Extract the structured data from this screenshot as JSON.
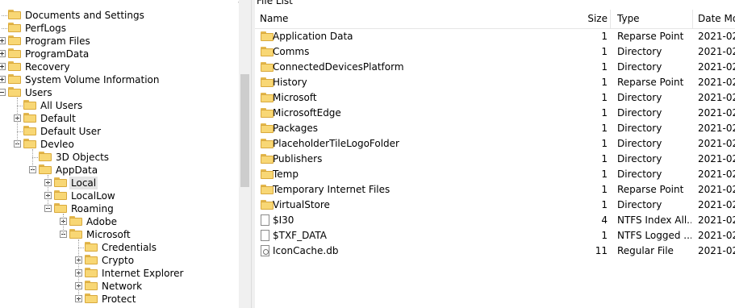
{
  "tree": {
    "close_glyph": "×",
    "items": [
      {
        "label": "Documents and Settings",
        "depth": 0,
        "expander": "none"
      },
      {
        "label": "PerfLogs",
        "depth": 0,
        "expander": "none"
      },
      {
        "label": "Program Files",
        "depth": 0,
        "expander": "plus"
      },
      {
        "label": "ProgramData",
        "depth": 0,
        "expander": "plus"
      },
      {
        "label": "Recovery",
        "depth": 0,
        "expander": "plus"
      },
      {
        "label": "System Volume Information",
        "depth": 0,
        "expander": "plus"
      },
      {
        "label": "Users",
        "depth": 0,
        "expander": "minus"
      },
      {
        "label": "All Users",
        "depth": 1,
        "expander": "none"
      },
      {
        "label": "Default",
        "depth": 1,
        "expander": "plus"
      },
      {
        "label": "Default User",
        "depth": 1,
        "expander": "none"
      },
      {
        "label": "Devleo",
        "depth": 1,
        "expander": "minus"
      },
      {
        "label": "3D Objects",
        "depth": 2,
        "expander": "none"
      },
      {
        "label": "AppData",
        "depth": 2,
        "expander": "minus"
      },
      {
        "label": "Local",
        "depth": 3,
        "expander": "plus",
        "selected": true
      },
      {
        "label": "LocalLow",
        "depth": 3,
        "expander": "plus"
      },
      {
        "label": "Roaming",
        "depth": 3,
        "expander": "minus"
      },
      {
        "label": "Adobe",
        "depth": 4,
        "expander": "plus"
      },
      {
        "label": "Microsoft",
        "depth": 4,
        "expander": "minus"
      },
      {
        "label": "Credentials",
        "depth": 5,
        "expander": "none"
      },
      {
        "label": "Crypto",
        "depth": 5,
        "expander": "plus"
      },
      {
        "label": "Internet Explorer",
        "depth": 5,
        "expander": "plus"
      },
      {
        "label": "Network",
        "depth": 5,
        "expander": "plus"
      },
      {
        "label": "Protect",
        "depth": 5,
        "expander": "plus"
      }
    ]
  },
  "list": {
    "title": "File List",
    "columns": {
      "name": "Name",
      "size": "Size",
      "type": "Type",
      "date": "Date Mo"
    },
    "rows": [
      {
        "icon": "folder",
        "name": "Application Data",
        "size": "1",
        "type": "Reparse Point",
        "date": "2021-02"
      },
      {
        "icon": "folder",
        "name": "Comms",
        "size": "1",
        "type": "Directory",
        "date": "2021-02"
      },
      {
        "icon": "folder",
        "name": "ConnectedDevicesPlatform",
        "size": "1",
        "type": "Directory",
        "date": "2021-02"
      },
      {
        "icon": "folder",
        "name": "History",
        "size": "1",
        "type": "Reparse Point",
        "date": "2021-02"
      },
      {
        "icon": "folder",
        "name": "Microsoft",
        "size": "1",
        "type": "Directory",
        "date": "2021-02"
      },
      {
        "icon": "folder",
        "name": "MicrosoftEdge",
        "size": "1",
        "type": "Directory",
        "date": "2021-02"
      },
      {
        "icon": "folder",
        "name": "Packages",
        "size": "1",
        "type": "Directory",
        "date": "2021-02"
      },
      {
        "icon": "folder",
        "name": "PlaceholderTileLogoFolder",
        "size": "1",
        "type": "Directory",
        "date": "2021-02"
      },
      {
        "icon": "folder",
        "name": "Publishers",
        "size": "1",
        "type": "Directory",
        "date": "2021-02"
      },
      {
        "icon": "folder",
        "name": "Temp",
        "size": "1",
        "type": "Directory",
        "date": "2021-02"
      },
      {
        "icon": "folder",
        "name": "Temporary Internet Files",
        "size": "1",
        "type": "Reparse Point",
        "date": "2021-02"
      },
      {
        "icon": "folder",
        "name": "VirtualStore",
        "size": "1",
        "type": "Directory",
        "date": "2021-02"
      },
      {
        "icon": "file",
        "name": "$I30",
        "size": "4",
        "type": "NTFS Index All...",
        "date": "2021-02"
      },
      {
        "icon": "file",
        "name": "$TXF_DATA",
        "size": "1",
        "type": "NTFS Logged ...",
        "date": "2021-02"
      },
      {
        "icon": "file-gear",
        "name": "IconCache.db",
        "size": "11",
        "type": "Regular File",
        "date": "2021-02"
      }
    ]
  }
}
